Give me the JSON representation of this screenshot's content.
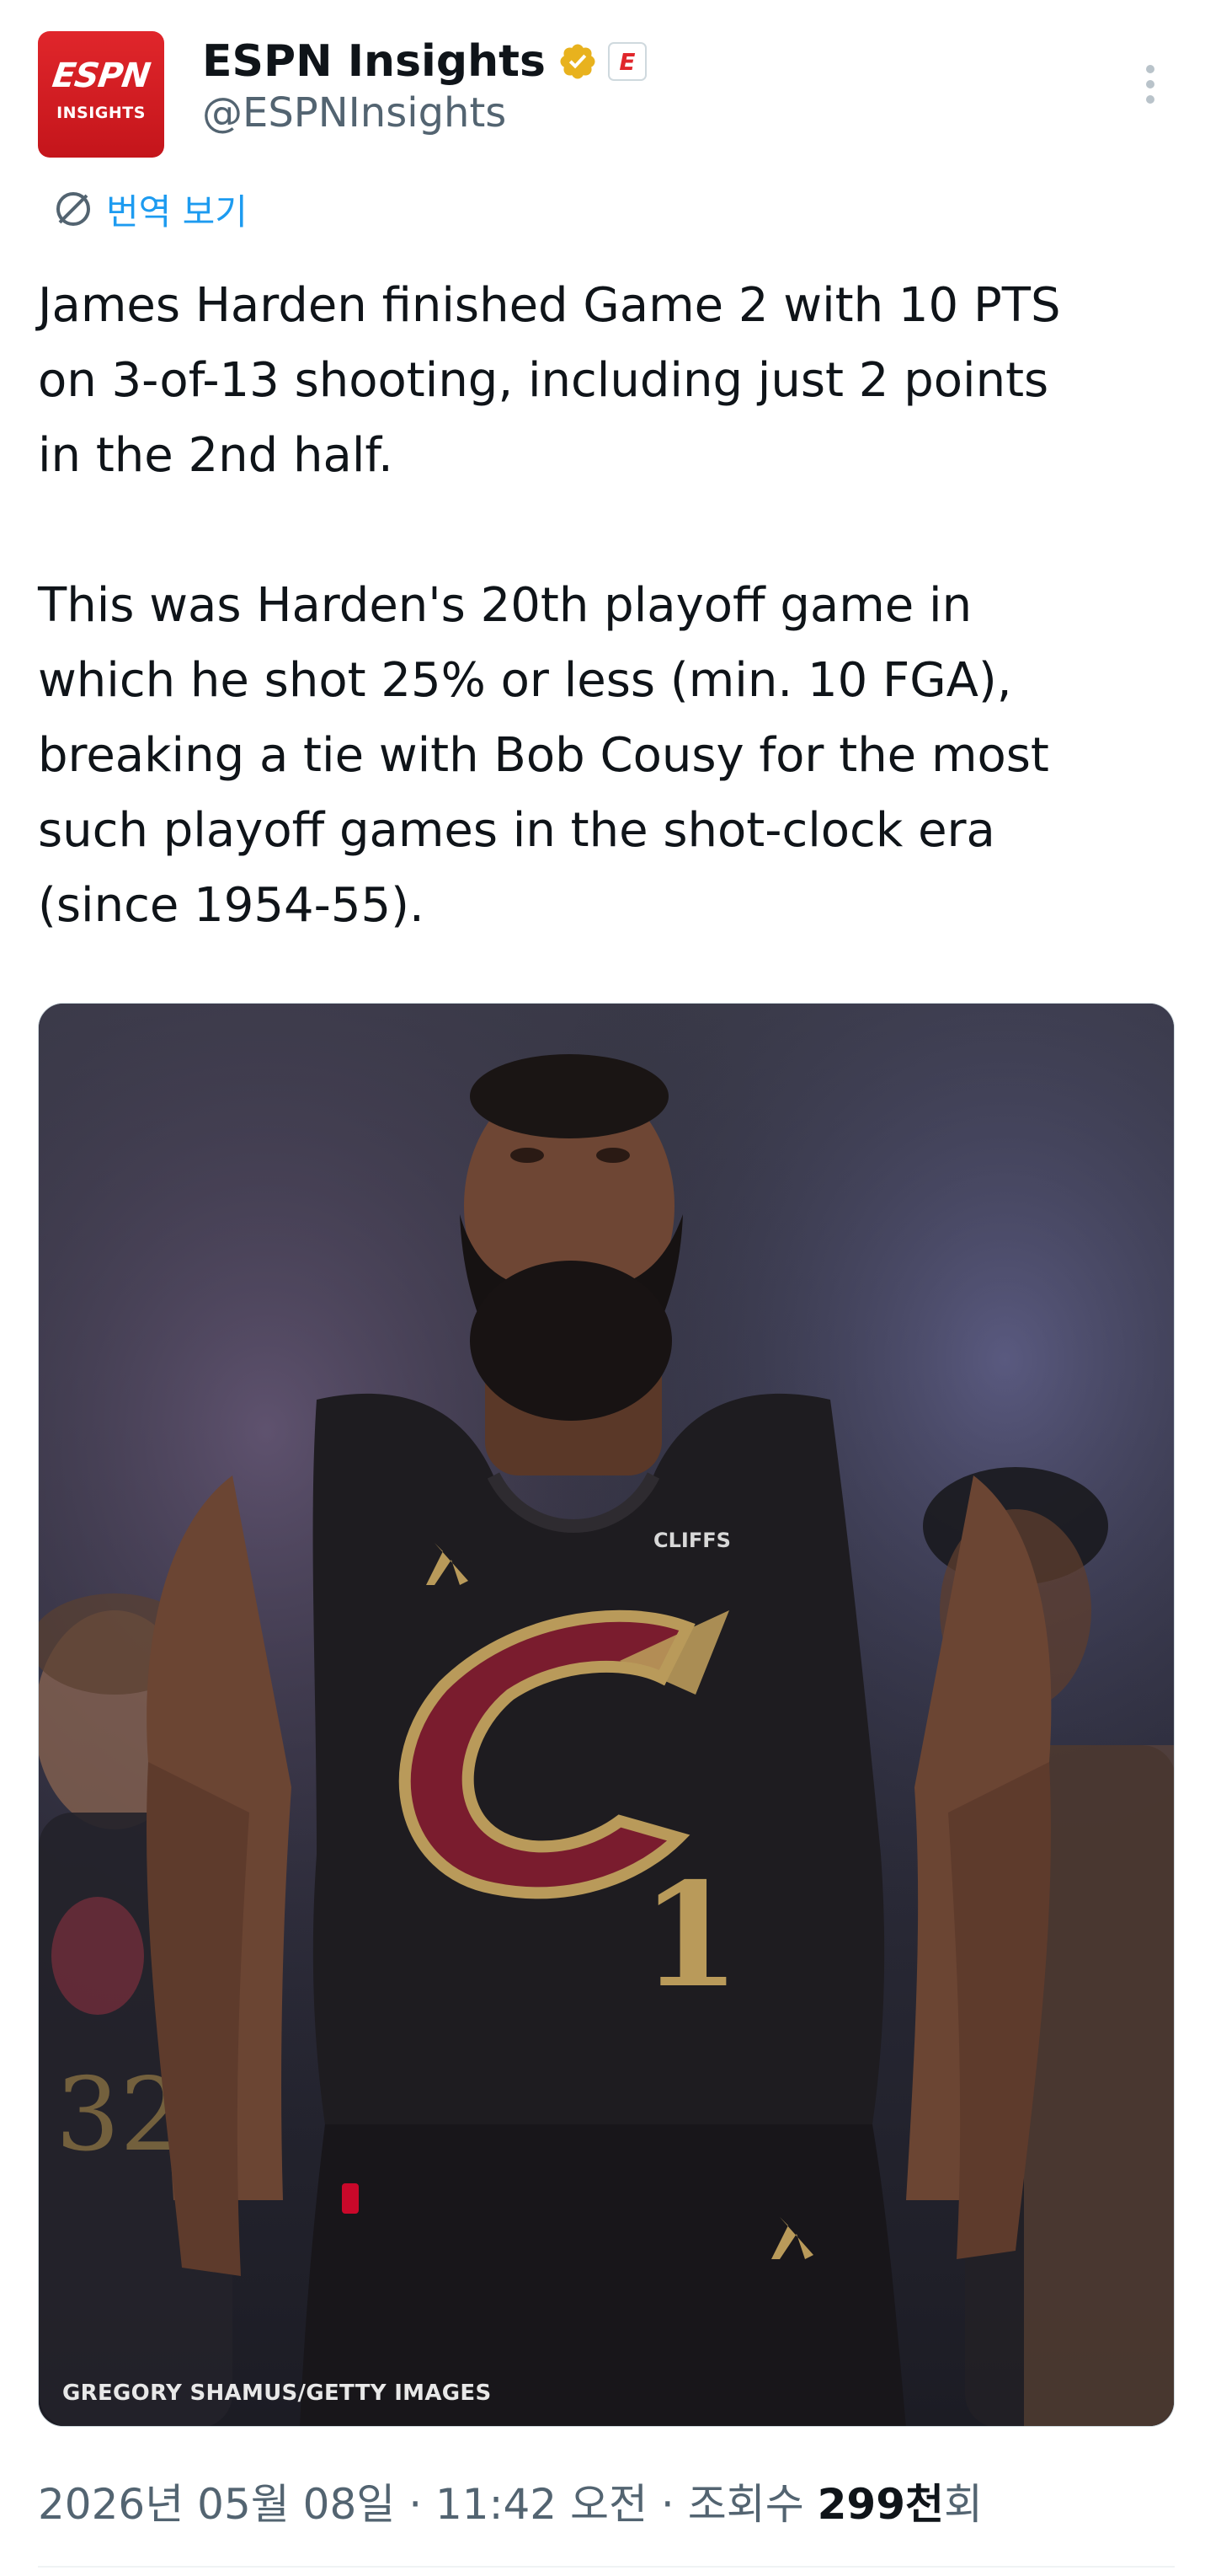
{
  "author": {
    "display_name": "ESPN Insights",
    "handle": "@ESPNInsights",
    "avatar_logo": "ESPN",
    "avatar_sub": "INSIGHTS",
    "verified_color": "#e8b21e",
    "affiliation_badge": "E"
  },
  "translate_label": "번역 보기",
  "tweet": {
    "lines_p1": [
      "James Harden finished Game 2 with 10 PTS",
      "on 3-of-13 shooting, including just 2 points",
      "in the 2nd half."
    ],
    "lines_p2": [
      "This was Harden's 20th playoff game in",
      "which he shot 25% or less (min. 10 FGA),",
      "breaking a tie with Bob Cousy for the most",
      "such playoff games in the shot-clock era",
      "(since 1954-55)."
    ]
  },
  "media": {
    "photo_credit": "GREGORY SHAMUS/GETTY IMAGES",
    "jersey_sponsor": "CLIFFS",
    "jersey_number": "1"
  },
  "meta": {
    "date": "2026년 05월 08일",
    "time": "11:42 오전",
    "views_label": "조회수",
    "views_count": "299천",
    "views_suffix": "회",
    "separator": "·"
  },
  "colors": {
    "accent_blue": "#1d9bf0",
    "espn_red": "#e0262b",
    "secondary_text": "#536471"
  }
}
